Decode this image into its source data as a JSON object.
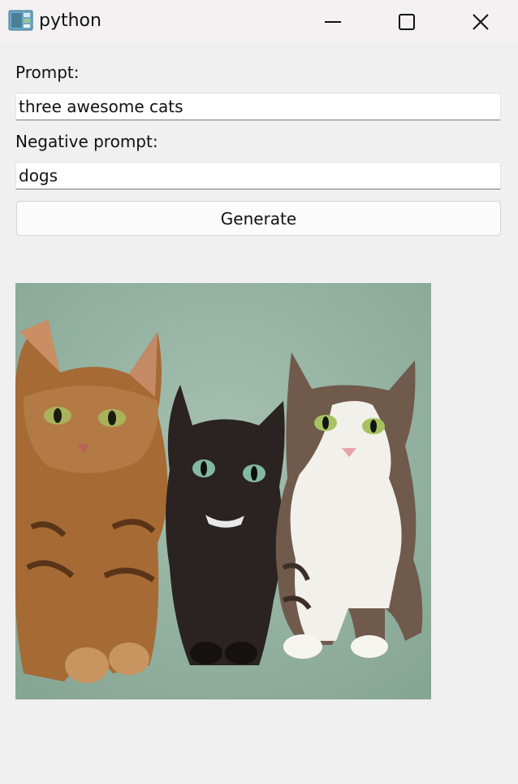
{
  "window": {
    "title": "python",
    "controls": {
      "minimize": "minimize-icon",
      "maximize": "maximize-icon",
      "close": "close-icon"
    }
  },
  "form": {
    "prompt_label": "Prompt:",
    "prompt_value": "three awesome cats",
    "negative_label": "Negative prompt:",
    "negative_value": "dogs",
    "generate_label": "Generate"
  },
  "result": {
    "image": "three-cats-generated-image",
    "colors": {
      "background": "#8fae9d",
      "tabby": "#a66a35",
      "black_cat": "#2a2321",
      "white_cat": "#f2f0ea",
      "cat_eyes": "#9fc060"
    }
  }
}
